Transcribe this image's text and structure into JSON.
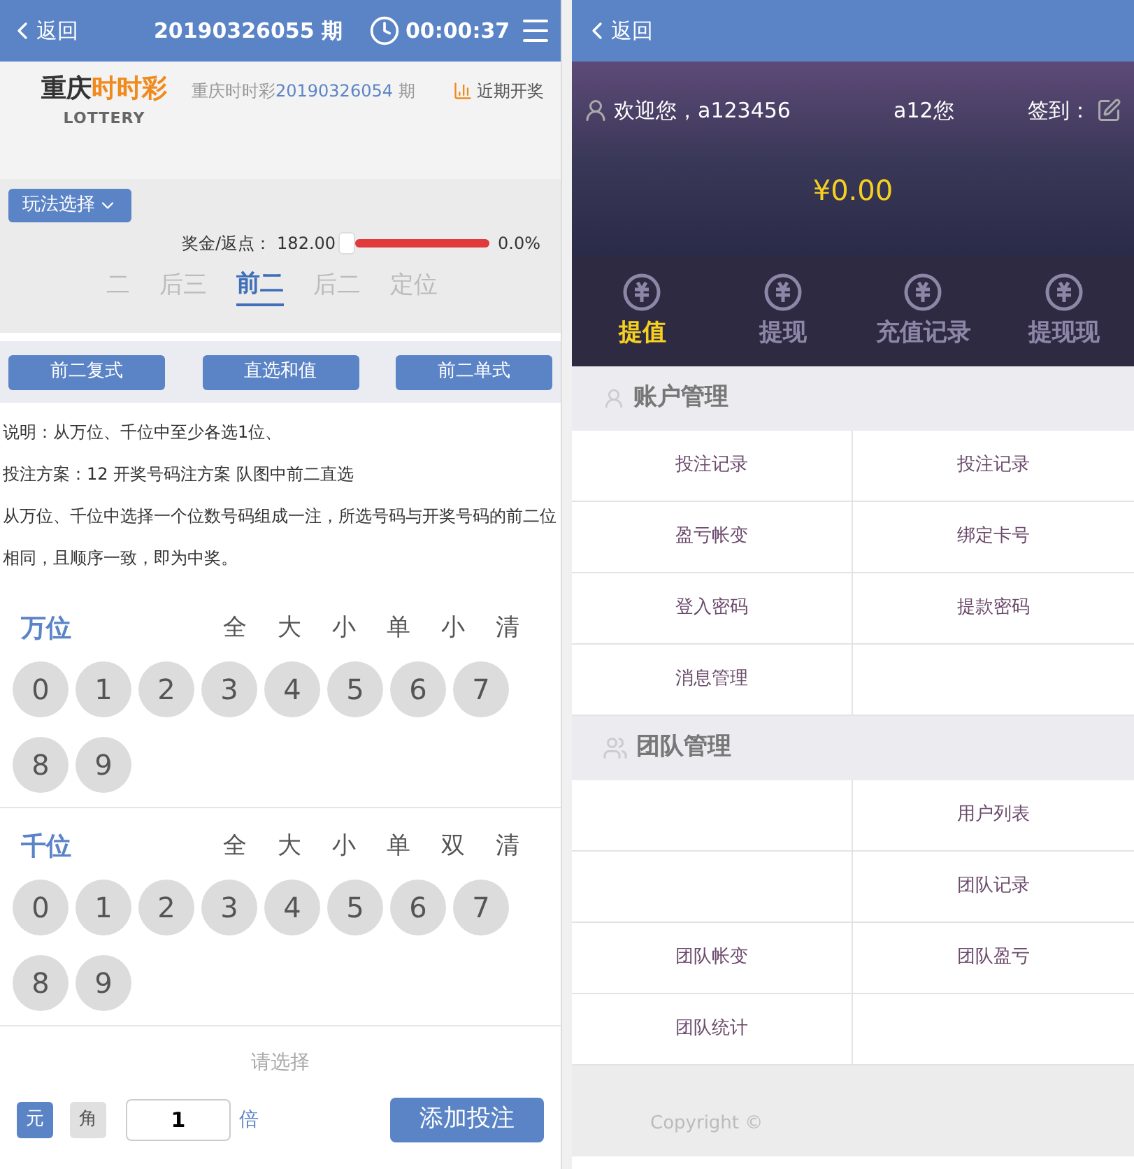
{
  "bet_screen": {
    "header": {
      "back": "返回",
      "issue": "20190326055 期",
      "countdown": "00:00:37"
    },
    "lottery": {
      "logo_dark": "重庆",
      "logo_accent": "时时彩",
      "logo_sub": "LOTTERY",
      "last_issue_prefix": "重庆时时彩",
      "last_issue_number": "20190326054",
      "last_issue_suffix": "期",
      "recent_draws": "近期开奖"
    },
    "play_select": "玩法选择",
    "rebate": {
      "label": "奖金/返点：",
      "value": "182.00",
      "level": 1,
      "percent": "0.0%"
    },
    "tabs": [
      {
        "label": "二",
        "selected": false
      },
      {
        "label": "后三",
        "selected": false
      },
      {
        "label": "前二",
        "selected": true
      },
      {
        "label": "后二",
        "selected": false
      },
      {
        "label": "定位",
        "selected": false
      }
    ],
    "sub_buttons": [
      "前二复式",
      "直选和值",
      "前二单式"
    ],
    "description": [
      "说明：从万位、千位中至少各选1位、",
      "投注方案：12 开奖号码注方案 队图中前二直选",
      "从万位、千位中选择一个位数号码组成一注，所选号码与开奖号码的前二位相同，且顺序一致，即为中奖。"
    ],
    "positions": [
      {
        "name": "万位",
        "options": [
          "全",
          "大",
          "小",
          "单",
          "小",
          "清"
        ],
        "balls": [
          {
            "label": "0",
            "selected": false
          },
          {
            "label": "1",
            "selected": false
          },
          {
            "label": "2",
            "selected": false
          },
          {
            "label": "3",
            "selected": false
          },
          {
            "label": "4",
            "selected": false
          },
          {
            "label": "5",
            "selected": false
          },
          {
            "label": "6",
            "selected": false
          },
          {
            "label": "7",
            "selected": false
          },
          {
            "label": "8",
            "selected": false
          },
          {
            "label": "9",
            "selected": false
          }
        ]
      },
      {
        "name": "千位",
        "options": [
          "全",
          "大",
          "小",
          "单",
          "双",
          "清"
        ],
        "balls": [
          {
            "label": "0",
            "selected": false
          },
          {
            "label": "1",
            "selected": false
          },
          {
            "label": "2",
            "selected": false
          },
          {
            "label": "3",
            "selected": false
          },
          {
            "label": "4",
            "selected": false
          },
          {
            "label": "5",
            "selected": false
          },
          {
            "label": "6",
            "selected": false
          },
          {
            "label": "7",
            "selected": false
          },
          {
            "label": "8",
            "selected": false
          },
          {
            "label": "9",
            "selected": false
          }
        ]
      }
    ],
    "hint": "请选择",
    "units": [
      {
        "label": "元",
        "selected": true
      },
      {
        "label": "角",
        "selected": false
      }
    ],
    "multiplier": {
      "value": "1",
      "suffix": "倍"
    },
    "add_bet": "添加投注"
  },
  "account_screen": {
    "header": {
      "back": "返回"
    },
    "welcome": "欢迎您，a123456",
    "nickname": "a12您",
    "sign_in": "签到：",
    "balance": "¥0.00",
    "actions": [
      {
        "label": "提值",
        "selected": true
      },
      {
        "label": "提现",
        "selected": false
      },
      {
        "label": "充值记录",
        "selected": false
      },
      {
        "label": "提现现",
        "selected": false
      }
    ],
    "sections": [
      {
        "title": "账户管理",
        "kind": "person",
        "rows": [
          {
            "left": "投注记录",
            "right": "投注记录"
          },
          {
            "left": "盈亏帐变",
            "right": "绑定卡号"
          },
          {
            "left": "登入密码",
            "right": "提款密码"
          },
          {
            "left": "消息管理"
          }
        ]
      },
      {
        "title": "团队管理",
        "kind": "group",
        "rows": [
          {
            "right": "用户列表"
          },
          {
            "right": "团队记录"
          },
          {
            "left": "团队帐变",
            "right": "团队盈亏"
          },
          {
            "left": "团队统计"
          }
        ]
      }
    ],
    "copyright": "Copyright ©"
  }
}
